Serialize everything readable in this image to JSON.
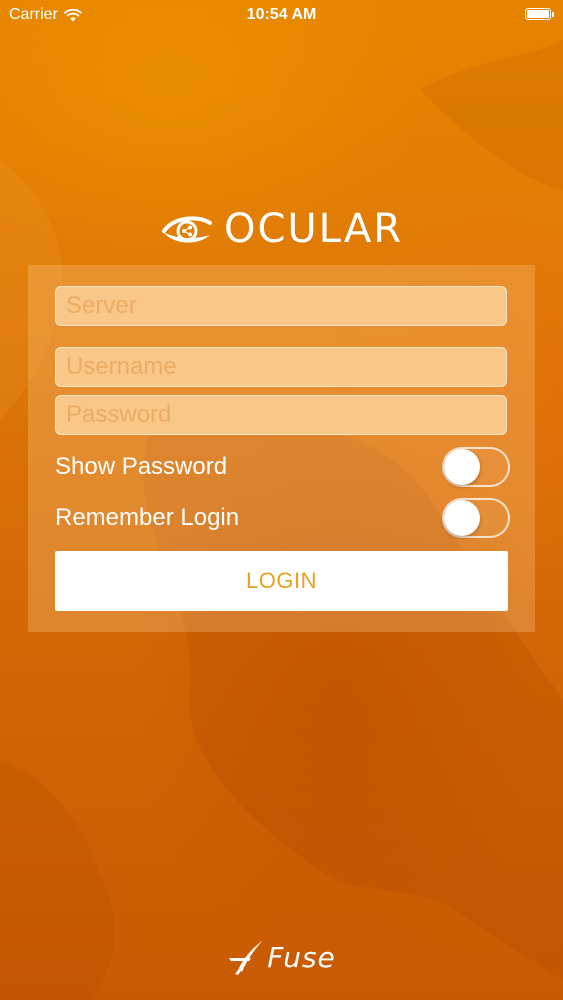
{
  "status_bar": {
    "carrier": "Carrier",
    "time": "10:54 AM",
    "battery_level": 1.0
  },
  "brand": {
    "logo_icon": "eye-share-icon",
    "name": "OCULAR"
  },
  "form": {
    "server_placeholder": "Server",
    "username_placeholder": "Username",
    "password_placeholder": "Password",
    "show_password_label": "Show Password",
    "show_password_on": false,
    "remember_login_label": "Remember Login",
    "remember_login_on": false,
    "login_label": "LOGIN"
  },
  "footer": {
    "logo_icon": "fuse-logo-icon",
    "brand": "Fuse"
  },
  "colors": {
    "background": "#d97206",
    "field_fill": "#f9c889",
    "placeholder": "#ecab63",
    "login_text": "#e8a11c"
  }
}
